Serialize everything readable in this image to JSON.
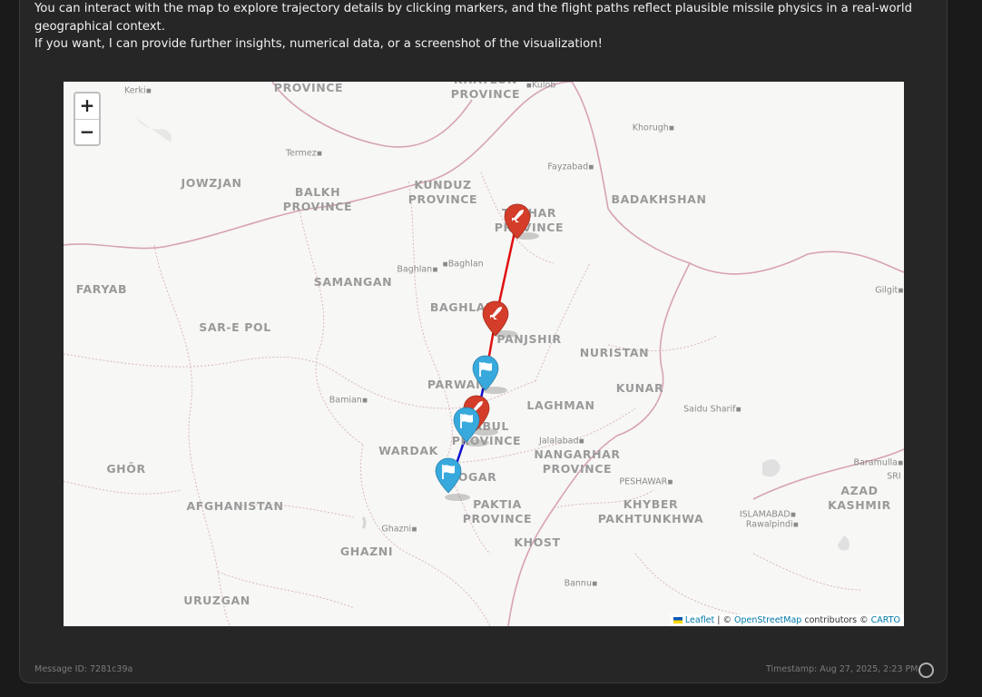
{
  "message": {
    "line1": "You can interact with the map to explore trajectory details by clicking markers, and the flight paths reflect plausible missile physics in a real-world geographical context.",
    "line2": "If you want, I can provide further insights, numerical data, or a screenshot of the visualization!"
  },
  "map": {
    "zoom_in": "+",
    "zoom_out": "−",
    "attribution": {
      "leaflet": "Leaflet",
      "sep1": " | © ",
      "osm": "OpenStreetMap",
      "contributors": " contributors © ",
      "carto": "CARTO"
    },
    "regions": [
      {
        "id": "province-top",
        "text": "PROVINCE"
      },
      {
        "id": "khatlon",
        "text": "KHATLON PROVINCE"
      },
      {
        "id": "jowzjan",
        "text": "JOWZJAN"
      },
      {
        "id": "balkh",
        "text": "BALKH PROVINCE"
      },
      {
        "id": "kunduz",
        "text": "KUNDUZ PROVINCE"
      },
      {
        "id": "takhar",
        "text": "TAKHAR PROVINCE"
      },
      {
        "id": "badakhshan",
        "text": "BADAKHSHAN"
      },
      {
        "id": "faryab",
        "text": "FARYAB"
      },
      {
        "id": "samangan",
        "text": "SAMANGAN"
      },
      {
        "id": "baghlan",
        "text": "BAGHLAN"
      },
      {
        "id": "sarepol",
        "text": "SAR-E POL"
      },
      {
        "id": "panjshir",
        "text": "PANJSHIR"
      },
      {
        "id": "nuristan",
        "text": "NURISTAN"
      },
      {
        "id": "parwan",
        "text": "PARWAN"
      },
      {
        "id": "kunar",
        "text": "KUNAR"
      },
      {
        "id": "laghman",
        "text": "LAGHMAN"
      },
      {
        "id": "kabul",
        "text": "KABUL PROVINCE"
      },
      {
        "id": "nangarhar",
        "text": "NANGARHAR PROVINCE"
      },
      {
        "id": "wardak",
        "text": "WARDAK"
      },
      {
        "id": "ghor",
        "text": "GHŌR"
      },
      {
        "id": "logar",
        "text": "LOGAR"
      },
      {
        "id": "azad",
        "text": "AZAD KASHMIR"
      },
      {
        "id": "afghanistan",
        "text": "AFGHANISTAN"
      },
      {
        "id": "paktia",
        "text": "PAKTIA PROVINCE"
      },
      {
        "id": "kpk",
        "text": "KHYBER PAKHTUNKHWA"
      },
      {
        "id": "ghazni",
        "text": "GHAZNI"
      },
      {
        "id": "khost",
        "text": "KHOST"
      },
      {
        "id": "uruzgan",
        "text": "URUZGAN"
      }
    ],
    "cities": [
      {
        "id": "kerki",
        "text": "Kerki"
      },
      {
        "id": "kulob",
        "text": "Kulob"
      },
      {
        "id": "khorugh",
        "text": "Khorugh"
      },
      {
        "id": "termez",
        "text": "Termez"
      },
      {
        "id": "fayzabad",
        "text": "Fayzabad"
      },
      {
        "id": "baghlan1",
        "text": "Baghlan"
      },
      {
        "id": "baghlan2",
        "text": "Baghlan"
      },
      {
        "id": "gilgit",
        "text": "Gilgit"
      },
      {
        "id": "bamian",
        "text": "Bamian"
      },
      {
        "id": "saidu",
        "text": "Saidu Sharif"
      },
      {
        "id": "jalalabad",
        "text": "Jalalabad"
      },
      {
        "id": "baramulla",
        "text": "Baramulla"
      },
      {
        "id": "sri",
        "text": "SRI"
      },
      {
        "id": "peshawar",
        "text": "PESHAWAR"
      },
      {
        "id": "islamabad",
        "text": "ISLAMABAD"
      },
      {
        "id": "rawalpindi",
        "text": "Rawalpindi"
      },
      {
        "id": "ghazni-city",
        "text": "Ghazni"
      },
      {
        "id": "bannu",
        "text": "Bannu"
      }
    ]
  },
  "footer": {
    "message_id": "Message ID: 7281c39a",
    "timestamp": "Timestamp: Aug 27, 2025, 2:23 PM"
  },
  "colors": {
    "red_path": "#e01010",
    "blue_path": "#1010d0",
    "red_marker": "#d33d29",
    "blue_marker": "#38a9dc"
  }
}
